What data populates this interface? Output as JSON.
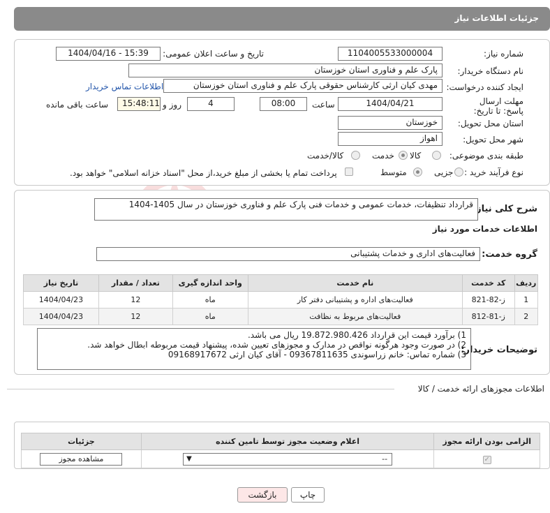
{
  "header": {
    "title": "جزئیات اطلاعات نیاز"
  },
  "form": {
    "need_number_label": "شماره نیاز:",
    "need_number": "1104005533000004",
    "announce_label": "تاریخ و ساعت اعلان عمومی:",
    "announce_value": "1404/04/16 - 15:39",
    "buyer_org_label": "نام دستگاه خریدار:",
    "buyer_org": "پارک علم و فناوری استان خوزستان",
    "creator_label": "ایجاد کننده درخواست:",
    "creator": "مهدی کیان ارثی کارشناس حقوقی پارک علم و فناوری استان خوزستان",
    "contact_link": "اطلاعات تماس خریدار",
    "deadline_label": "مهلت ارسال پاسخ: تا تاریخ:",
    "deadline_date": "1404/04/21",
    "time_label": "ساعت",
    "deadline_time": "08:00",
    "days_value": "4",
    "days_label": "روز و",
    "remaining_time": "15:48:11",
    "remaining_label": "ساعت باقی مانده",
    "province_label": "استان محل تحویل:",
    "province": "خوزستان",
    "city_label": "شهر محل تحویل:",
    "city": "اهواز",
    "category_label": "طبقه بندی موضوعی:",
    "cat_goods": "کالا",
    "cat_service": "خدمت",
    "cat_goods_service": "کالا/خدمت",
    "process_label": "نوع فرآیند خرید :",
    "proc_small": "جزیی",
    "proc_medium": "متوسط",
    "payment_note": "پرداخت تمام یا بخشی از مبلغ خرید،از محل \"اسناد خزانه اسلامی\" خواهد بود."
  },
  "summary": {
    "label": "شرح کلی نیاز:",
    "text": "قرارداد تنظیفات، خدمات عمومی و خدمات فنی پارک علم و فناوری خوزستان در سال 1405-1404"
  },
  "services": {
    "section_title": "اطلاعات خدمات مورد نیاز",
    "group_label": "گروه خدمت:",
    "group_value": "فعالیت‌های اداری و خدمات پشتیبانی",
    "columns": [
      "ردیف",
      "کد خدمت",
      "نام خدمت",
      "واحد اندازه گیری",
      "تعداد / مقدار",
      "تاریخ نیاز"
    ],
    "rows": [
      {
        "idx": "1",
        "code": "ز-82-821",
        "name": "فعالیت‌های اداره و پشتیبانی دفتر کار",
        "unit": "ماه",
        "qty": "12",
        "date": "1404/04/23"
      },
      {
        "idx": "2",
        "code": "ز-81-812",
        "name": "فعالیت‌های مربوط به نظافت",
        "unit": "ماه",
        "qty": "12",
        "date": "1404/04/23"
      }
    ]
  },
  "notes": {
    "label": "توضیحات خریدار:",
    "line1": "1) برآورد قیمت این قرارداد 19.872.980.426 ریال می باشد.",
    "line2": "2) در صورت وجود هرگونه نواقص در مدارک و مجوزهای تعیین شده، پیشنهاد قیمت مربوطه ابطال خواهد شد.",
    "line3": "3) شماره تماس: خانم زراسوندی 09367811635 - آقای کیان ارثی 09168917672"
  },
  "permits": {
    "section_title": "اطلاعات مجوزهای ارائه خدمت / کالا",
    "col_required": "الزامی بودن ارائه مجوز",
    "col_status": "اعلام وضعیت مجوز توسط تامین کننده",
    "col_details": "جزئیات",
    "select_value": "--",
    "view_button": "مشاهده مجوز"
  },
  "buttons": {
    "print": "چاپ",
    "back": "بازگشت"
  },
  "watermark": {
    "text": "AriaTender.neT"
  },
  "colors": {
    "header": "#8a8a8a",
    "link": "#2255aa",
    "back_button_bg": "#fde7e7"
  }
}
